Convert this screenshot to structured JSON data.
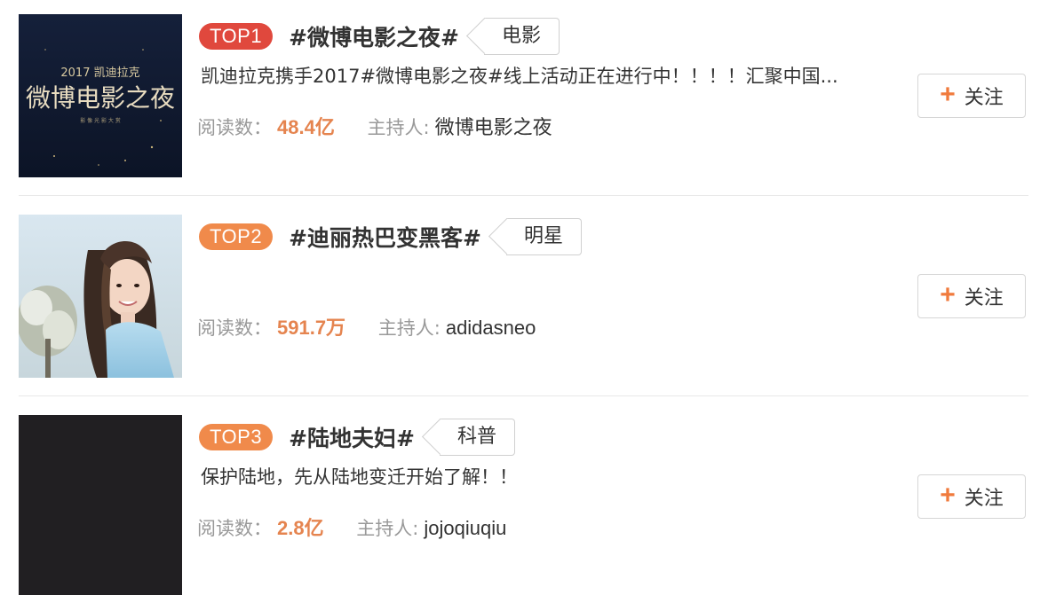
{
  "colors": {
    "top1_badge": "#e0483d",
    "top2_badge": "#f08a4b",
    "top3_badge": "#f08a4b",
    "reads_value": "#e5844f",
    "plus_icon": "#f07a3c"
  },
  "items": [
    {
      "rank": "TOP1",
      "topic": "#微博电影之夜#",
      "category": "电影",
      "description": "凯迪拉克携手2017#微博电影之夜#线上活动正在进行中！！！！汇聚中国...",
      "reads_label": "阅读数：",
      "reads_value": "48.4亿",
      "host_label": "主持人:",
      "host_name": "微博电影之夜",
      "follow_label": "关注",
      "thumb": {
        "small_text": "2017 凯迪拉克",
        "big_text": "微博电影之夜",
        "tiny_text": "影  像  光  影  大  赏"
      }
    },
    {
      "rank": "TOP2",
      "topic": "#迪丽热巴变黑客#",
      "category": "明星",
      "description": "",
      "reads_label": "阅读数：",
      "reads_value": "591.7万",
      "host_label": "主持人:",
      "host_name": "adidasneo",
      "follow_label": "关注"
    },
    {
      "rank": "TOP3",
      "topic": "#陆地夫妇#",
      "category": "科普",
      "description": "保护陆地，先从陆地变迁开始了解！！",
      "reads_label": "阅读数：",
      "reads_value": "2.8亿",
      "host_label": "主持人:",
      "host_name": "jojoqiuqiu",
      "follow_label": "关注"
    }
  ]
}
